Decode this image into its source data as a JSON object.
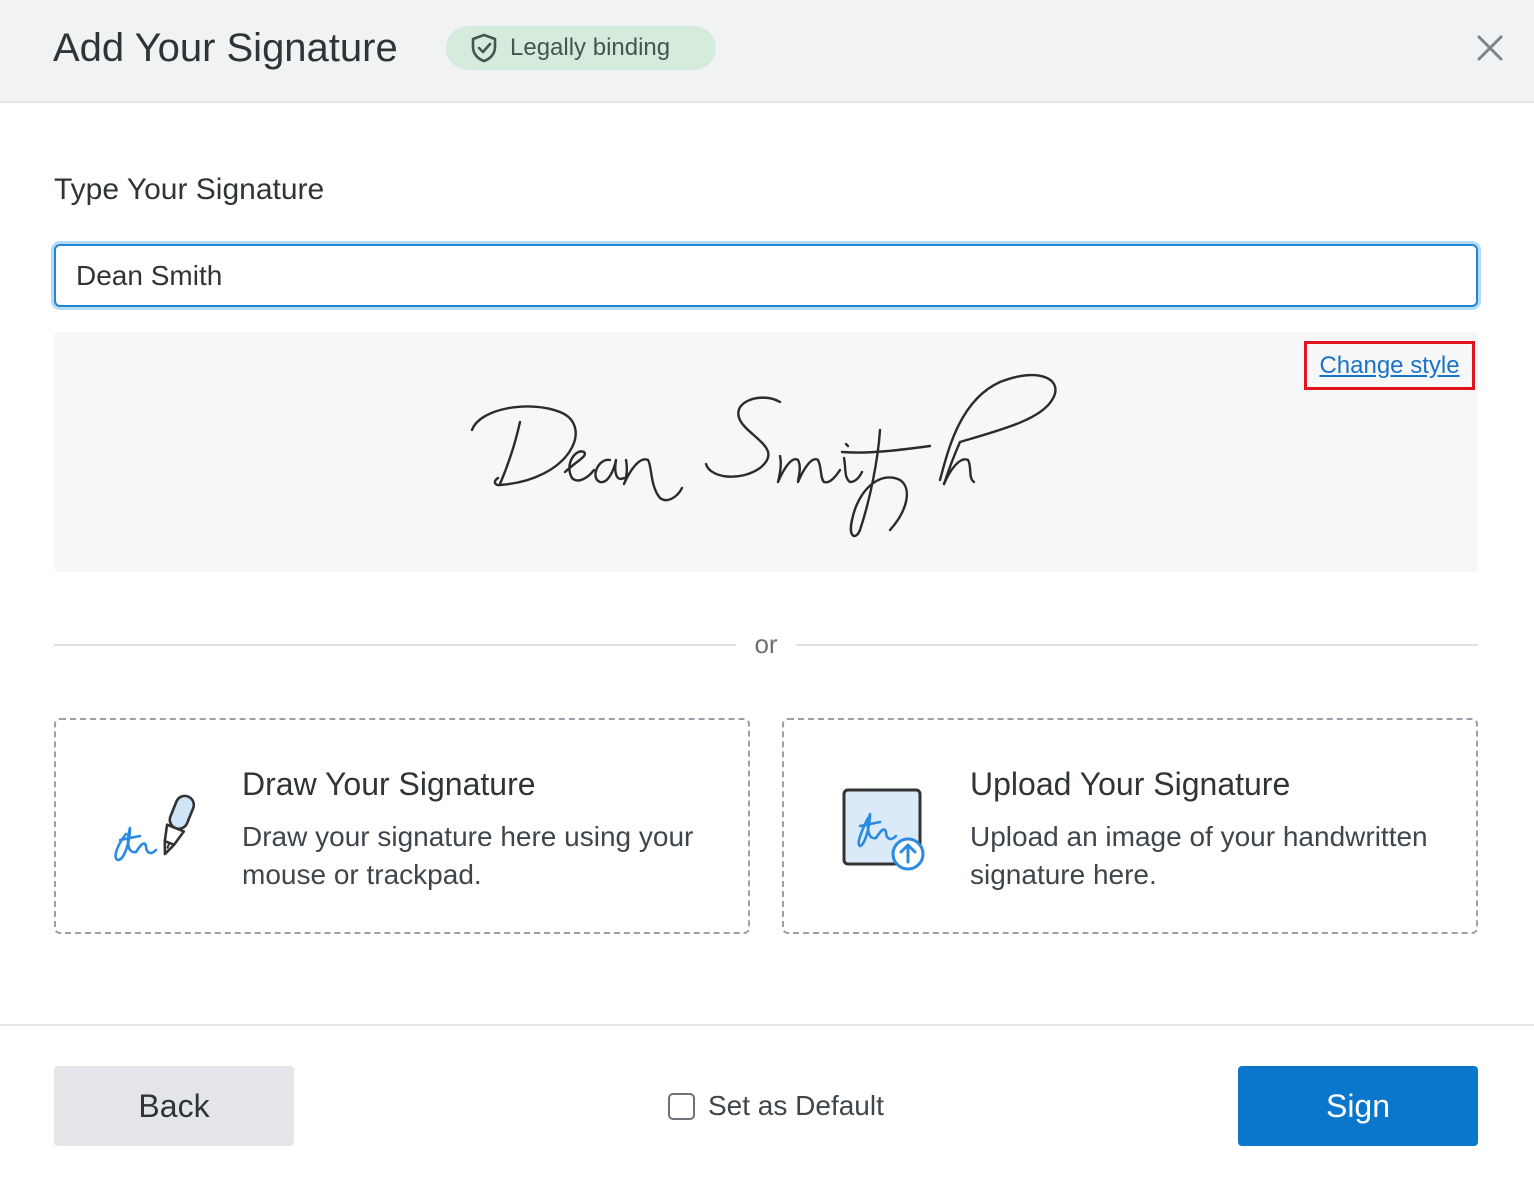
{
  "header": {
    "title": "Add Your Signature",
    "badge_label": "Legally binding",
    "badge_icon": "shield-check-icon",
    "close_icon": "close-icon"
  },
  "type_section": {
    "label": "Type Your Signature",
    "input_value": "Dean Smith",
    "preview_text": "Dean Smith",
    "change_style_label": "Change style"
  },
  "divider": {
    "text": "or"
  },
  "options": [
    {
      "title": "Draw Your Signature",
      "description": "Draw your signature here using your mouse or trackpad.",
      "icon": "pen-signature-icon"
    },
    {
      "title": "Upload Your Signature",
      "description": "Upload an image of your handwritten signature here.",
      "icon": "upload-signature-icon"
    }
  ],
  "footer": {
    "back_label": "Back",
    "default_label": "Set as Default",
    "default_checked": false,
    "sign_label": "Sign"
  },
  "colors": {
    "accent": "#0a77cc",
    "badge_bg": "#d5ecdd",
    "highlight_border": "#e0141e"
  }
}
